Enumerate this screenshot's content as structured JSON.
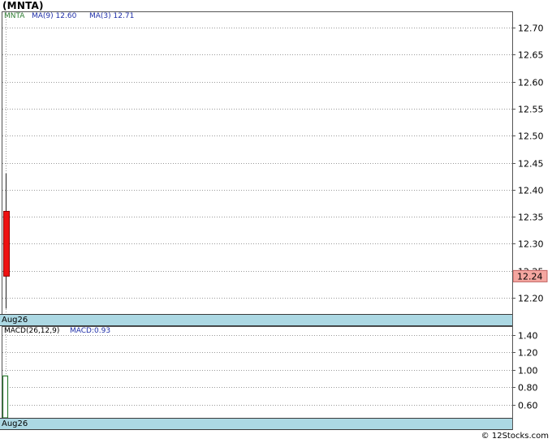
{
  "title": "(MNTA)",
  "legend": {
    "symbol": "MNTA",
    "ma9": "MA(9)  12.60",
    "ma3": "MA(3)  12.71",
    "macd_name": "MACD(26,12,9)",
    "macd_value": "MACD:0.93"
  },
  "date_label_main": "Aug26",
  "date_label_macd": "Aug26",
  "credit": "© 12Stocks.com",
  "colors": {
    "bearish_candle": "#ee1111",
    "macd_bar": "#2e7d32",
    "date_strip": "#acd8e3",
    "last_price_marker": "#f4a6a0"
  },
  "chart_data": [
    {
      "type": "candlestick",
      "title": "(MNTA)",
      "ylim": [
        12.17,
        12.73
      ],
      "yticks": [
        "12.70",
        "12.65",
        "12.60",
        "12.55",
        "12.50",
        "12.45",
        "12.40",
        "12.35",
        "12.30",
        "12.25",
        "12.20"
      ],
      "categories": [
        "Aug26"
      ],
      "series": [
        {
          "name": "MNTA",
          "candles": [
            {
              "date": "Aug26",
              "open": 12.36,
              "high": 12.43,
              "low": 12.18,
              "close": 12.24
            }
          ]
        }
      ],
      "last_price_label": "12.24",
      "grid": true
    },
    {
      "type": "bar",
      "title": "MACD(26,12,9)",
      "ylim": [
        0.45,
        1.5
      ],
      "yticks": [
        "1.40",
        "1.20",
        "1.00",
        "0.80",
        "0.60"
      ],
      "categories": [
        "Aug26"
      ],
      "series": [
        {
          "name": "MACD",
          "values": [
            0.93
          ]
        }
      ],
      "grid": true
    }
  ]
}
